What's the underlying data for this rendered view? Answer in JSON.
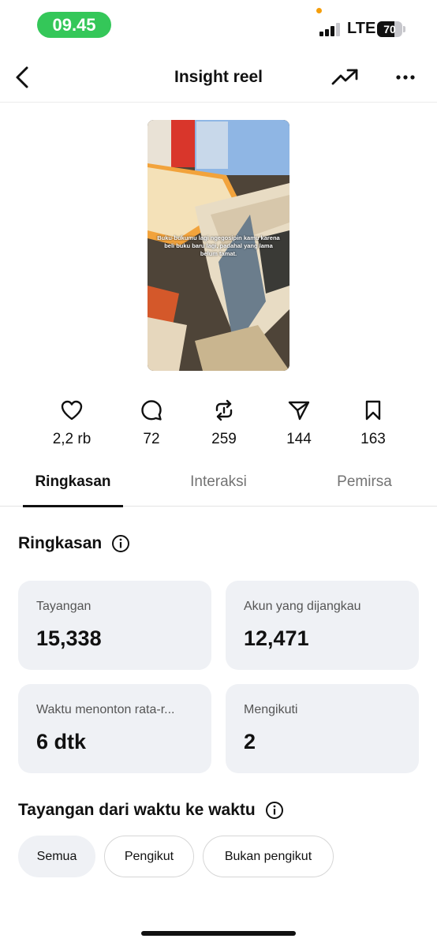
{
  "status_bar": {
    "time": "09.45",
    "network": "LTE",
    "battery": "70",
    "battery_level": 0.7,
    "signal_bars_filled": 3,
    "signal_bars_total": 4
  },
  "header": {
    "title": "Insight reel"
  },
  "reel": {
    "caption": "Buku-bukumu lagi ngegosipin kamu karena beli buku baru lagi, padahal yang lama belum tamat."
  },
  "stats": {
    "likes": "2,2 rb",
    "comments": "72",
    "reposts": "259",
    "shares": "144",
    "saves": "163"
  },
  "tabs": [
    {
      "label": "Ringkasan",
      "active": true
    },
    {
      "label": "Interaksi",
      "active": false
    },
    {
      "label": "Pemirsa",
      "active": false
    }
  ],
  "summary": {
    "title": "Ringkasan",
    "cards": [
      {
        "label": "Tayangan",
        "value": "15,338"
      },
      {
        "label": "Akun yang dijangkau",
        "value": "12,471"
      },
      {
        "label": "Waktu menonton rata-r...",
        "value": "6 dtk"
      },
      {
        "label": "Mengikuti",
        "value": "2"
      }
    ]
  },
  "views_over_time": {
    "title": "Tayangan dari waktu ke waktu",
    "filters": [
      {
        "label": "Semua",
        "selected": true
      },
      {
        "label": "Pengikut",
        "selected": false
      },
      {
        "label": "Bukan pengikut",
        "selected": false
      }
    ]
  },
  "colors": {
    "time_pill": "#34c759",
    "card_bg": "#eff1f5",
    "camera_dot": "#f59e0b"
  }
}
